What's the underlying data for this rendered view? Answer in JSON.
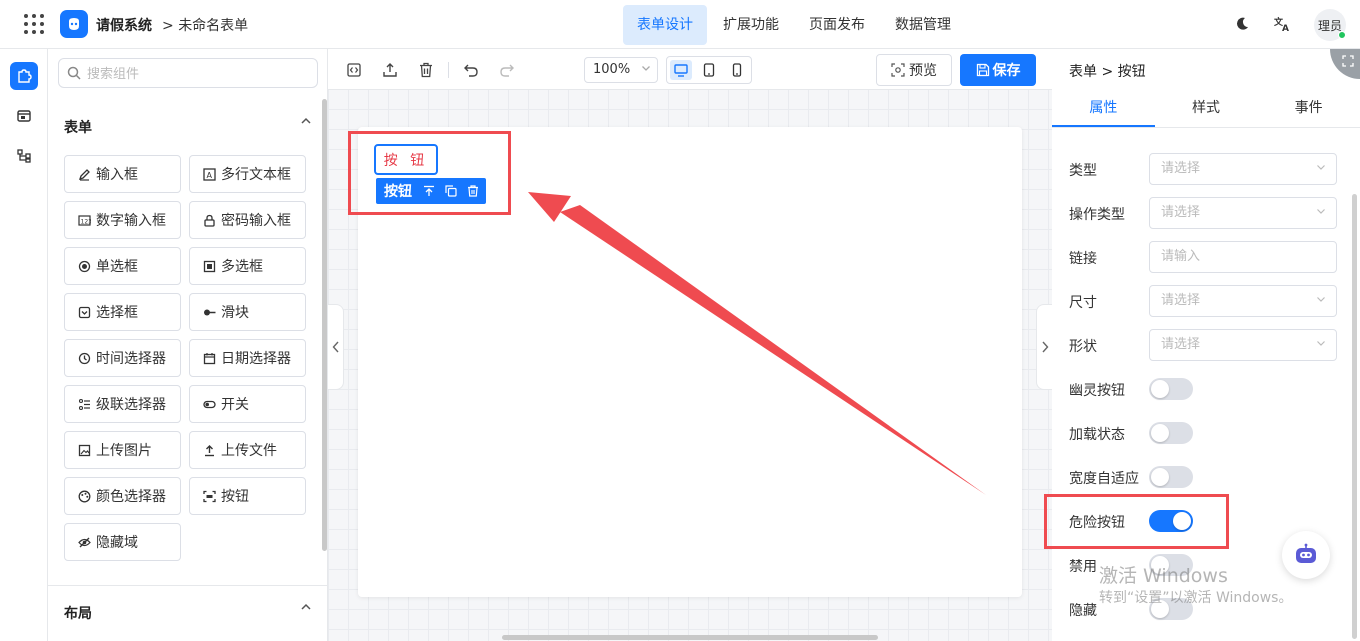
{
  "header": {
    "app_name": "请假系统",
    "breadcrumb_sep": ">",
    "form_name": "未命名表单",
    "tabs": [
      {
        "label": "表单设计",
        "active": true
      },
      {
        "label": "扩展功能",
        "active": false
      },
      {
        "label": "页面发布",
        "active": false
      },
      {
        "label": "数据管理",
        "active": false
      }
    ],
    "avatar_text": "理员",
    "icons": [
      "apps-grid-icon",
      "app-logo-icon",
      "moon-icon",
      "translate-icon"
    ]
  },
  "sidebar_rail": {
    "items": [
      {
        "icon": "component-icon",
        "active": true
      },
      {
        "icon": "template-icon",
        "active": false
      },
      {
        "icon": "tree-icon",
        "active": false
      }
    ]
  },
  "component_panel": {
    "search_placeholder": "搜索组件",
    "form_section": {
      "title": "表单",
      "items": [
        {
          "label": "输入框",
          "icon": "edit-icon"
        },
        {
          "label": "多行文本框",
          "icon": "textarea-icon"
        },
        {
          "label": "数字输入框",
          "icon": "number-icon"
        },
        {
          "label": "密码输入框",
          "icon": "lock-icon"
        },
        {
          "label": "单选框",
          "icon": "radio-icon"
        },
        {
          "label": "多选框",
          "icon": "checkbox-icon"
        },
        {
          "label": "选择框",
          "icon": "select-icon"
        },
        {
          "label": "滑块",
          "icon": "slider-icon"
        },
        {
          "label": "时间选择器",
          "icon": "clock-icon"
        },
        {
          "label": "日期选择器",
          "icon": "calendar-icon"
        },
        {
          "label": "级联选择器",
          "icon": "cascader-icon"
        },
        {
          "label": "开关",
          "icon": "switch-icon"
        },
        {
          "label": "上传图片",
          "icon": "image-icon"
        },
        {
          "label": "上传文件",
          "icon": "upload-icon"
        },
        {
          "label": "颜色选择器",
          "icon": "palette-icon"
        },
        {
          "label": "按钮",
          "icon": "button-icon"
        },
        {
          "label": "隐藏域",
          "icon": "eye-off-icon"
        }
      ]
    },
    "layout_section": {
      "title": "布局"
    }
  },
  "canvas": {
    "zoom": "100%",
    "preview_label": "预览",
    "save_label": "保存",
    "button_text": "按 钮",
    "selection_label": "按钮",
    "devices": [
      {
        "icon": "desktop-icon",
        "active": true
      },
      {
        "icon": "tablet-icon",
        "active": false
      },
      {
        "icon": "mobile-icon",
        "active": false
      }
    ]
  },
  "properties": {
    "breadcrumb": "表单 > 按钮",
    "tabs": [
      {
        "label": "属性",
        "active": true
      },
      {
        "label": "样式",
        "active": false
      },
      {
        "label": "事件",
        "active": false
      }
    ],
    "fields": [
      {
        "label": "类型",
        "placeholder": "请选择",
        "kind": "select"
      },
      {
        "label": "操作类型",
        "placeholder": "请选择",
        "kind": "select"
      },
      {
        "label": "链接",
        "placeholder": "请输入",
        "kind": "input"
      },
      {
        "label": "尺寸",
        "placeholder": "请选择",
        "kind": "select"
      },
      {
        "label": "形状",
        "placeholder": "请选择",
        "kind": "select"
      }
    ],
    "switches": [
      {
        "label": "幽灵按钮",
        "on": false
      },
      {
        "label": "加载状态",
        "on": false
      },
      {
        "label": "宽度自适应",
        "on": false
      },
      {
        "label": "危险按钮",
        "on": true
      },
      {
        "label": "禁用",
        "on": false
      },
      {
        "label": "隐藏",
        "on": false
      }
    ]
  },
  "watermark": {
    "line1": "激活 Windows",
    "line2": "转到“设置”以激活 Windows。"
  },
  "colors": {
    "accent": "#1677ff",
    "danger_text": "#e63946",
    "annotation": "#ef4b50"
  }
}
